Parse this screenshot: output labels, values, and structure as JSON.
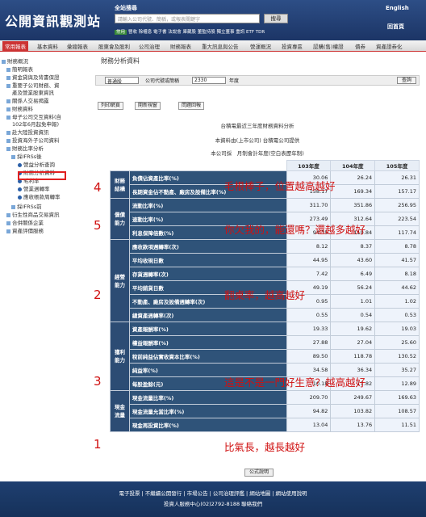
{
  "header": {
    "logo": "公開資訊觀測站",
    "search_label": "全站搜尋",
    "search_placeholder": "請輸入公司代號、簡稱，或報表關鍵字",
    "search_button": "搜尋",
    "quick_pill": "常用",
    "quick_links": "營收 除權息 電子書 法說會 庫藏股 董監持股 獨立董事 重訊 ETF TDR",
    "english": "English",
    "sitemap": "回首頁"
  },
  "nav": [
    "常用報表",
    "基本資料",
    "彙總報表",
    "股東會及股利",
    "公司治理",
    "財務報表",
    "重大訊息與公告",
    "營運概況",
    "投資專區",
    "認購(售)權證",
    "債券",
    "資產證券化"
  ],
  "sidebar": {
    "items": [
      "財務概況",
      "簡明報表",
      "資金貸與及背書保證",
      "重要子公司財務、資",
      "產及營業股東資訊",
      "關係人交易揭露",
      "財務資料",
      "母子公司交互資料(自",
      "102年6月起免申報)",
      "赴大陸投資資訊",
      "投資海外子公司資料",
      "財務比率分析",
      "採IFRSs後",
      "營益分析查詢",
      "財務分析資料",
      "毛利率",
      "營業週轉率",
      "應收帳款周轉率",
      "採IFRSs前",
      "衍生性商品交易資訊",
      "合併關係企業",
      "資產評價服務"
    ]
  },
  "page": {
    "title": "財務分析資料",
    "market_select": "普通股",
    "code_label": "公司代號或簡稱",
    "code_value": "2330",
    "year_label": "年度",
    "query_button": "查詢",
    "toolbar": [
      "列印網頁",
      "開新視窗",
      "問題回報"
    ],
    "report_title": "台積電最近三年度財務資料分析",
    "source_line": "本資料由(上市公司) 台積電公司提供",
    "basis_line": "本公司採　月制會計年度(空白表歷年制)",
    "footer_button": "公式說明"
  },
  "table": {
    "columns": [
      "103年度",
      "104年度",
      "105年度"
    ],
    "groups": [
      {
        "label": "財務結構",
        "rows": [
          {
            "metric": "負債佔資產比率(%)",
            "values": [
              "30.06",
              "26.24",
              "26.31"
            ]
          },
          {
            "metric": "長期資金佔不動產、廠房及設備比率(%)",
            "values": [
              "158.17",
              "169.34",
              "157.17"
            ]
          }
        ]
      },
      {
        "label": "償債能力",
        "rows": [
          {
            "metric": "流動比率(%)",
            "values": [
              "311.70",
              "351.86",
              "256.95"
            ]
          },
          {
            "metric": "速動比率(%)",
            "values": [
              "273.49",
              "312.64",
              "223.54"
            ]
          },
          {
            "metric": "利息保障倍數(%)",
            "values": [
              "94.35",
              "110.84",
              "117.74"
            ]
          }
        ]
      },
      {
        "label": "經營能力",
        "rows": [
          {
            "metric": "應收款項週轉率(次)",
            "values": [
              "8.12",
              "8.37",
              "8.78"
            ]
          },
          {
            "metric": "平均收現日數",
            "values": [
              "44.95",
              "43.60",
              "41.57"
            ]
          },
          {
            "metric": "存貨週轉率(次)",
            "values": [
              "7.42",
              "6.49",
              "8.18"
            ]
          },
          {
            "metric": "平均銷貨日數",
            "values": [
              "49.19",
              "56.24",
              "44.62"
            ]
          },
          {
            "metric": "不動產、廠房及設備週轉率(次)",
            "values": [
              "0.95",
              "1.01",
              "1.02"
            ]
          },
          {
            "metric": "總資產週轉率(次)",
            "values": [
              "0.55",
              "0.54",
              "0.53"
            ]
          }
        ]
      },
      {
        "label": "獲利能力",
        "rows": [
          {
            "metric": "資產報酬率(%)",
            "values": [
              "19.33",
              "19.62",
              "19.03"
            ]
          },
          {
            "metric": "權益報酬率(%)",
            "values": [
              "27.88",
              "27.04",
              "25.60"
            ]
          },
          {
            "metric": "稅前純益佔實收資本比率(%)",
            "values": [
              "89.50",
              "118.78",
              "130.52"
            ]
          },
          {
            "metric": "純益率(%)",
            "values": [
              "34.58",
              "36.34",
              "35.27"
            ]
          },
          {
            "metric": "每股盈餘(元)",
            "values": [
              "10.18",
              "11.82",
              "12.89"
            ]
          }
        ]
      },
      {
        "label": "現金流量",
        "rows": [
          {
            "metric": "現金流量比率(%)",
            "values": [
              "209.70",
              "249.67",
              "169.63"
            ]
          },
          {
            "metric": "現金流量允當比率(%)",
            "values": [
              "94.82",
              "103.82",
              "108.57"
            ]
          },
          {
            "metric": "現金再投資比率(%)",
            "values": [
              "13.04",
              "13.76",
              "11.51"
            ]
          }
        ]
      }
    ]
  },
  "annotations": {
    "numbers": [
      "4",
      "5",
      "2",
      "3",
      "1"
    ],
    "notes": [
      "毛根棒子，位置越高越好",
      "你欠我的，能還嗎？還越多越好",
      "翻桌率，越高越好",
      "這是不是一門好生意？越高越好",
      "比氣長，越長越好"
    ]
  },
  "footer": {
    "links": "電子投票 | 不繼續公開發行 | 市場公告 | 公司治理評鑑 | 網站地圖 | 網站使用說明",
    "contact": "投資人服務中心(02)2792-8188 聯絡我們"
  },
  "colors": {
    "header": "#1c3566",
    "accent": "#cc3333",
    "row_header": "#2f5379",
    "note": "#d01010"
  }
}
